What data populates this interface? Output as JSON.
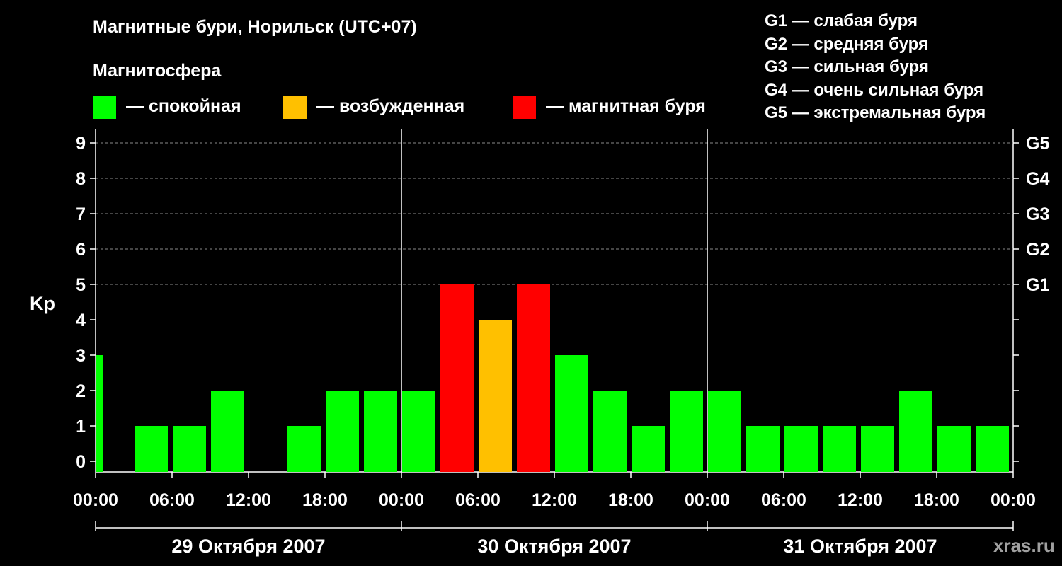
{
  "title": "Магнитные бури, Норильск (UTC+07)",
  "magnetosphere_label": "Магнитосфера",
  "legend": [
    {
      "label": "— спокойная",
      "color": "#00ff00"
    },
    {
      "label": "— возбужденная",
      "color": "#ffc000"
    },
    {
      "label": "— магнитная буря",
      "color": "#ff0000"
    }
  ],
  "storm_levels": [
    "G1 — слабая буря",
    "G2 — средняя буря",
    "G3 — сильная буря",
    "G4 — очень сильная буря",
    "G5 — экстремальная буря"
  ],
  "watermark": "xras.ru",
  "chart_data": {
    "type": "bar",
    "ylabel": "Kp",
    "ylim": [
      0,
      9
    ],
    "yticks": [
      "0",
      "1",
      "2",
      "3",
      "4",
      "5",
      "6",
      "7",
      "8",
      "9"
    ],
    "right_ticks": [
      {
        "kp": 5,
        "label": "G1"
      },
      {
        "kp": 6,
        "label": "G2"
      },
      {
        "kp": 7,
        "label": "G3"
      },
      {
        "kp": 8,
        "label": "G4"
      },
      {
        "kp": 9,
        "label": "G5"
      }
    ],
    "xticks": [
      "00:00",
      "06:00",
      "12:00",
      "18:00",
      "00:00",
      "06:00",
      "12:00",
      "18:00",
      "00:00",
      "06:00",
      "12:00",
      "18:00",
      "00:00"
    ],
    "days": [
      "29 Октября 2007",
      "30 Октября 2007",
      "31 Октября 2007"
    ],
    "grid_y": [
      5,
      6,
      7,
      8,
      9
    ],
    "bar_start_hours": [
      0,
      3,
      6,
      9,
      12,
      15,
      18,
      21,
      24,
      27,
      30,
      33,
      36,
      39,
      42,
      45,
      48,
      51,
      54,
      57,
      60,
      63,
      66,
      69
    ],
    "values": [
      3,
      1,
      1,
      2,
      0,
      1,
      2,
      2,
      2,
      5,
      4,
      5,
      3,
      2,
      1,
      2,
      2,
      1,
      1,
      1,
      1,
      2,
      1,
      1
    ],
    "first_bar_hours_visible": 0.5,
    "colors": [
      "#00ff00",
      "#00ff00",
      "#00ff00",
      "#00ff00",
      "#00ff00",
      "#00ff00",
      "#00ff00",
      "#00ff00",
      "#00ff00",
      "#ff0000",
      "#ffc000",
      "#ff0000",
      "#00ff00",
      "#00ff00",
      "#00ff00",
      "#00ff00",
      "#00ff00",
      "#00ff00",
      "#00ff00",
      "#00ff00",
      "#00ff00",
      "#00ff00",
      "#00ff00",
      "#00ff00"
    ]
  }
}
